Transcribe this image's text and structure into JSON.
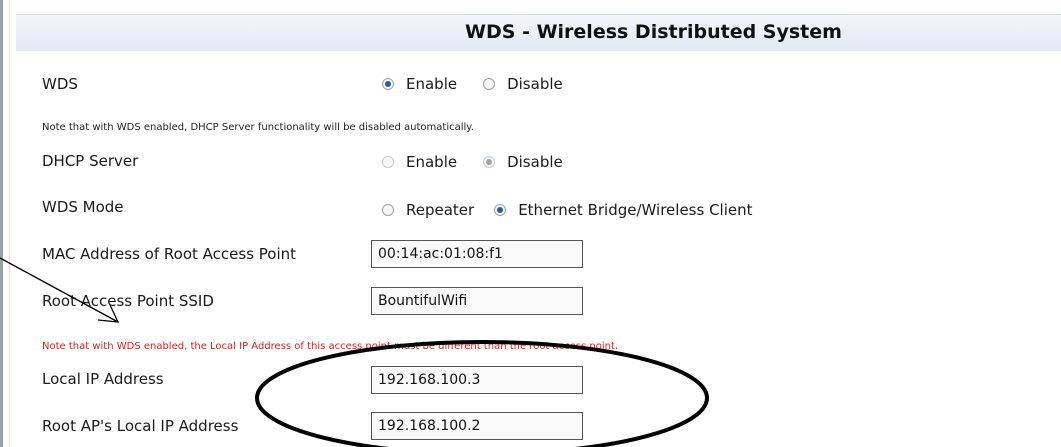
{
  "header": {
    "title": "WDS - Wireless Distributed System"
  },
  "wds": {
    "label": "WDS",
    "options": [
      {
        "label": "Enable",
        "checked": true
      },
      {
        "label": "Disable",
        "checked": false
      }
    ]
  },
  "note_dhcp": "Note that with WDS enabled, DHCP Server functionality will be disabled automatically.",
  "dhcp": {
    "label": "DHCP Server",
    "options": [
      {
        "label": "Enable",
        "checked": false
      },
      {
        "label": "Disable",
        "checked": true
      }
    ]
  },
  "wds_mode": {
    "label": "WDS Mode",
    "options": [
      {
        "label": "Repeater",
        "checked": false
      },
      {
        "label": "Ethernet Bridge/Wireless Client",
        "checked": true
      }
    ]
  },
  "mac": {
    "label": "MAC Address of Root Access Point",
    "value": "00:14:ac:01:08:f1"
  },
  "ssid": {
    "label": "Root Access Point SSID",
    "value": "BountifulWifi"
  },
  "note_ip": "Note that with WDS enabled, the Local IP Address of this access point must be different than the root access point.",
  "local_ip": {
    "label": "Local IP Address",
    "value": "192.168.100.3"
  },
  "root_ip": {
    "label": "Root AP's Local IP Address",
    "value": "192.168.100.2"
  },
  "colors": {
    "note_red": "#e0201a",
    "radio_checked": "#1e5fa8"
  }
}
